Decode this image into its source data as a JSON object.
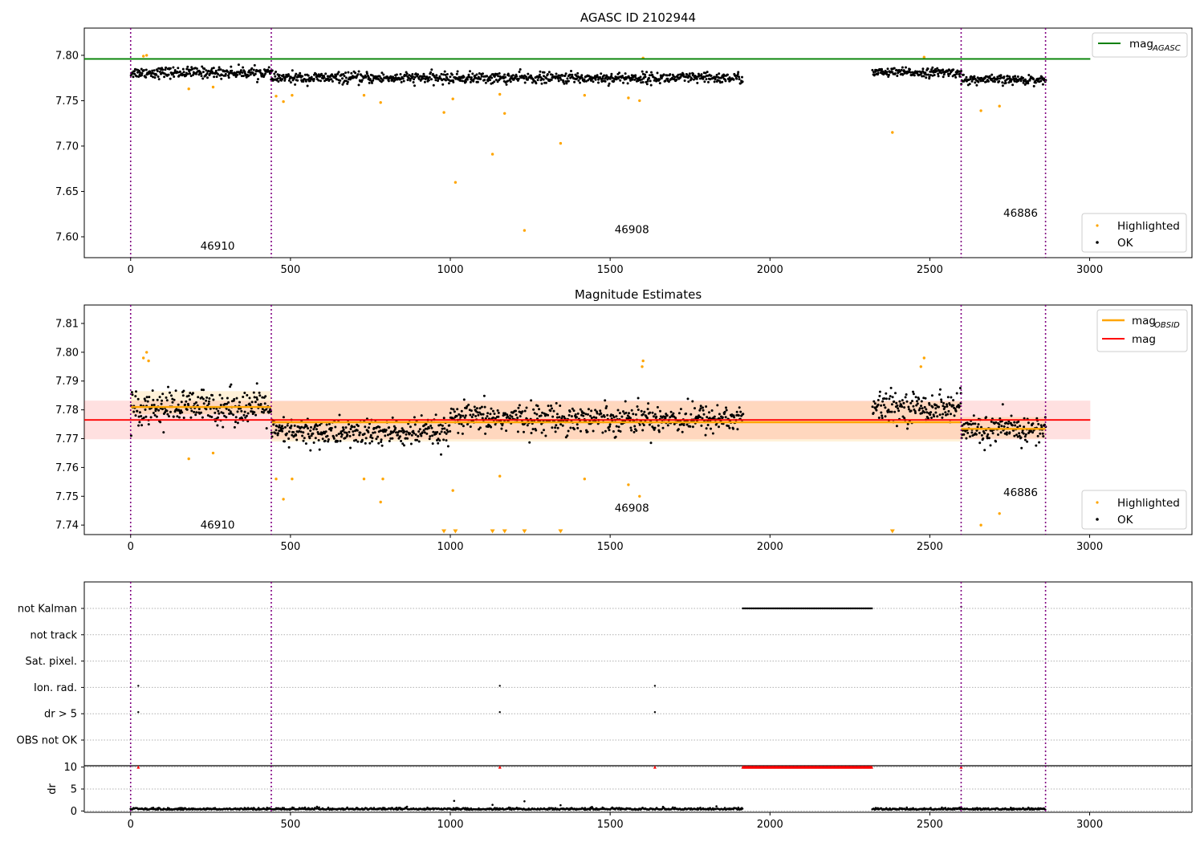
{
  "figure": {
    "obsids": [
      "46910",
      "46908",
      "46886"
    ],
    "obsid_boundaries": [
      0,
      440,
      2598,
      2862
    ]
  },
  "chart_data": [
    {
      "type": "scatter",
      "title": "AGASC ID 2102944",
      "xlim": [
        -145,
        3320
      ],
      "ylim": [
        7.577,
        7.83
      ],
      "x_ticks": [
        0,
        500,
        1000,
        1500,
        2000,
        2500,
        3000
      ],
      "y_ticks": [
        7.6,
        7.65,
        7.7,
        7.75,
        7.8
      ],
      "y_tick_labels": [
        "7.60",
        "7.65",
        "7.70",
        "7.75",
        "7.80"
      ],
      "series": [
        {
          "name": "OK",
          "color": "#000000",
          "segments": [
            {
              "x_start": 0,
              "x_end": 440,
              "y_mean": 7.781,
              "y_spread": 0.006
            },
            {
              "x_start": 440,
              "x_end": 1915,
              "y_mean": 7.775,
              "y_spread": 0.006
            },
            {
              "x_start": 2320,
              "x_end": 2598,
              "y_mean": 7.781,
              "y_spread": 0.005
            },
            {
              "x_start": 2598,
              "x_end": 2862,
              "y_mean": 7.773,
              "y_spread": 0.005
            }
          ]
        },
        {
          "name": "Highlighted",
          "color": "#ffa500",
          "points": [
            [
              40,
              7.799
            ],
            [
              50,
              7.8
            ],
            [
              182,
              7.763
            ],
            [
              258,
              7.765
            ],
            [
              455,
              7.755
            ],
            [
              478,
              7.749
            ],
            [
              505,
              7.756
            ],
            [
              730,
              7.756
            ],
            [
              782,
              7.748
            ],
            [
              980,
              7.737
            ],
            [
              1008,
              7.752
            ],
            [
              1016,
              7.66
            ],
            [
              1132,
              7.691
            ],
            [
              1155,
              7.757
            ],
            [
              1170,
              7.736
            ],
            [
              1232,
              7.607
            ],
            [
              1345,
              7.703
            ],
            [
              1420,
              7.756
            ],
            [
              1557,
              7.753
            ],
            [
              1592,
              7.75
            ],
            [
              1603,
              7.797
            ],
            [
              2383,
              7.715
            ],
            [
              2482,
              7.798
            ],
            [
              2660,
              7.739
            ],
            [
              2718,
              7.744
            ]
          ]
        },
        {
          "name": "mag$_{AGASC}$",
          "color": "#008000",
          "line_y": 7.796,
          "x_range": [
            -145,
            3002
          ]
        }
      ],
      "legend_left": [
        "mag",
        "AGASC"
      ],
      "legend_right": [
        "Highlighted",
        "OK"
      ],
      "obsid_labels": [
        {
          "text": "46910",
          "x": 218,
          "y": 7.586
        },
        {
          "text": "46908",
          "x": 1514,
          "y": 7.604
        },
        {
          "text": "46886",
          "x": 2730,
          "y": 7.622
        }
      ]
    },
    {
      "type": "scatter",
      "title": "Magnitude Estimates",
      "xlim": [
        -145,
        3320
      ],
      "ylim": [
        7.7367,
        7.8164
      ],
      "x_ticks": [
        0,
        500,
        1000,
        1500,
        2000,
        2500,
        3000
      ],
      "y_ticks": [
        7.74,
        7.75,
        7.76,
        7.77,
        7.78,
        7.79,
        7.8,
        7.81
      ],
      "y_tick_labels": [
        "7.74",
        "7.75",
        "7.76",
        "7.77",
        "7.78",
        "7.79",
        "7.80",
        "7.81"
      ],
      "mag": {
        "value": 7.7765,
        "band": [
          7.7698,
          7.7832
        ],
        "x_range": [
          -145,
          3002
        ],
        "color": "#ff0000"
      },
      "mag_obsid": [
        {
          "x_range": [
            0,
            440
          ],
          "value": 7.781,
          "band": [
            7.7785,
            7.7865
          ]
        },
        {
          "x_range": [
            440,
            2598
          ],
          "value": 7.7757,
          "band": [
            7.769,
            7.783
          ]
        },
        {
          "x_range": [
            2598,
            2862
          ],
          "value": 7.7734,
          "band": [
            7.77,
            7.7775
          ]
        }
      ],
      "series": [
        {
          "name": "OK",
          "color": "#000000",
          "segments": [
            {
              "x_start": 0,
              "x_end": 440,
              "y_mean": 7.781,
              "y_spread": 0.006
            },
            {
              "x_start": 440,
              "x_end": 1000,
              "y_mean": 7.772,
              "y_spread": 0.005
            },
            {
              "x_start": 1000,
              "x_end": 1915,
              "y_mean": 7.777,
              "y_spread": 0.005
            },
            {
              "x_start": 2320,
              "x_end": 2598,
              "y_mean": 7.781,
              "y_spread": 0.005
            },
            {
              "x_start": 2598,
              "x_end": 2862,
              "y_mean": 7.773,
              "y_spread": 0.005
            }
          ]
        },
        {
          "name": "Highlighted",
          "color": "#ffa500",
          "points": [
            [
              40,
              7.798
            ],
            [
              50,
              7.8
            ],
            [
              56,
              7.797
            ],
            [
              182,
              7.763
            ],
            [
              258,
              7.765
            ],
            [
              455,
              7.756
            ],
            [
              478,
              7.749
            ],
            [
              505,
              7.756
            ],
            [
              730,
              7.756
            ],
            [
              782,
              7.748
            ],
            [
              789,
              7.756
            ],
            [
              1008,
              7.752
            ],
            [
              1155,
              7.757
            ],
            [
              1420,
              7.756
            ],
            [
              1557,
              7.754
            ],
            [
              1592,
              7.75
            ],
            [
              1600,
              7.795
            ],
            [
              1603,
              7.797
            ],
            [
              2472,
              7.795
            ],
            [
              2482,
              7.798
            ],
            [
              2660,
              7.74
            ],
            [
              2718,
              7.744
            ]
          ]
        },
        {
          "name": "Highlighted (below axis)",
          "color": "#ffa500",
          "points": [
            [
              980,
              7.7376
            ],
            [
              1016,
              7.7376
            ],
            [
              1132,
              7.7376
            ],
            [
              1170,
              7.7376
            ],
            [
              1232,
              7.7376
            ],
            [
              1345,
              7.7376
            ],
            [
              2383,
              7.7376
            ]
          ]
        }
      ],
      "legend_left": [
        "mag",
        "OBSID"
      ],
      "legend_left_2": "mag",
      "legend_right": [
        "Highlighted",
        "OK"
      ],
      "obsid_labels": [
        {
          "text": "46910",
          "x": 218,
          "y": 7.7388
        },
        {
          "text": "46908",
          "x": 1514,
          "y": 7.7446
        },
        {
          "text": "46886",
          "x": 2730,
          "y": 7.7501
        }
      ]
    },
    {
      "type": "scatter",
      "title": "",
      "xlim": [
        -145,
        3320
      ],
      "flag_rows": [
        "not Kalman",
        "not track",
        "Sat. pixel.",
        "Ion. rad.",
        "dr > 5",
        "OBS not OK"
      ],
      "flags": {
        "not Kalman": {
          "range": [
            1915,
            2320
          ],
          "points": [
            2598
          ]
        },
        "not track": {
          "range": null,
          "points": []
        },
        "Sat. pixel.": {
          "range": null,
          "points": []
        },
        "Ion. rad.": {
          "range": null,
          "points": [
            24,
            1155,
            1640
          ]
        },
        "dr > 5": {
          "range": null,
          "points": [
            24,
            1155,
            1640
          ]
        },
        "OBS not OK": {
          "range": null,
          "points": []
        }
      }
    },
    {
      "type": "scatter",
      "title": "",
      "ylabel": "dr",
      "xlim": [
        -145,
        3320
      ],
      "ylim": [
        -0.3,
        10.3
      ],
      "x_ticks": [
        0,
        500,
        1000,
        1500,
        2000,
        2500,
        3000
      ],
      "y_ticks": [
        0,
        5,
        10
      ],
      "y_tick_labels": [
        "0",
        "5",
        "10"
      ],
      "segments": [
        {
          "x_start": 0,
          "x_end": 1915,
          "y_mean": 0.3
        },
        {
          "x_start": 2320,
          "x_end": 2862,
          "y_mean": 0.3
        }
      ],
      "extra_points": [
        [
          1012,
          2.3
        ],
        [
          1132,
          1.4
        ],
        [
          1232,
          2.2
        ],
        [
          1345,
          1.3
        ],
        [
          2598,
          0.8
        ]
      ],
      "clipped_range": [
        1915,
        2320
      ],
      "clipped_points": [
        24,
        1155,
        1640,
        2598
      ],
      "clip_value": 10
    }
  ]
}
